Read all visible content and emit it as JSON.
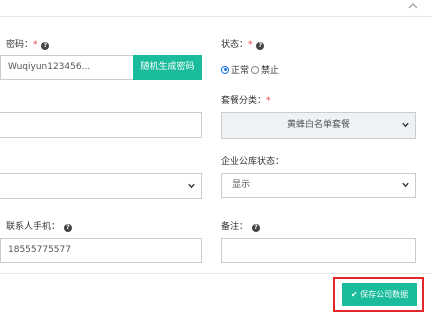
{
  "header": {
    "collapse_icon": "chevron-up-icon"
  },
  "form": {
    "password": {
      "label": "密码：",
      "required": "*",
      "value": "Wuqiyun123456...",
      "generate_button": "随机生成密码"
    },
    "status": {
      "label": "状态：",
      "required": "*",
      "options": [
        {
          "label": "正常",
          "selected": true
        },
        {
          "label": "禁止",
          "selected": false
        }
      ]
    },
    "package": {
      "label": "套餐分类：",
      "required": "*",
      "value": "黄蜂白名单套餐"
    },
    "public_status": {
      "label": "企业公库状态：",
      "value": "显示"
    },
    "contact_phone": {
      "label": "联系人手机：",
      "value": "18555775577"
    },
    "remark": {
      "label": "备注：",
      "value": ""
    }
  },
  "footer": {
    "save_label": "✔ 保存公司数据"
  },
  "colors": {
    "accent": "#1bbc9b",
    "highlight": "#e3262b",
    "required": "#e4393c",
    "radio": "#1a73e8"
  }
}
